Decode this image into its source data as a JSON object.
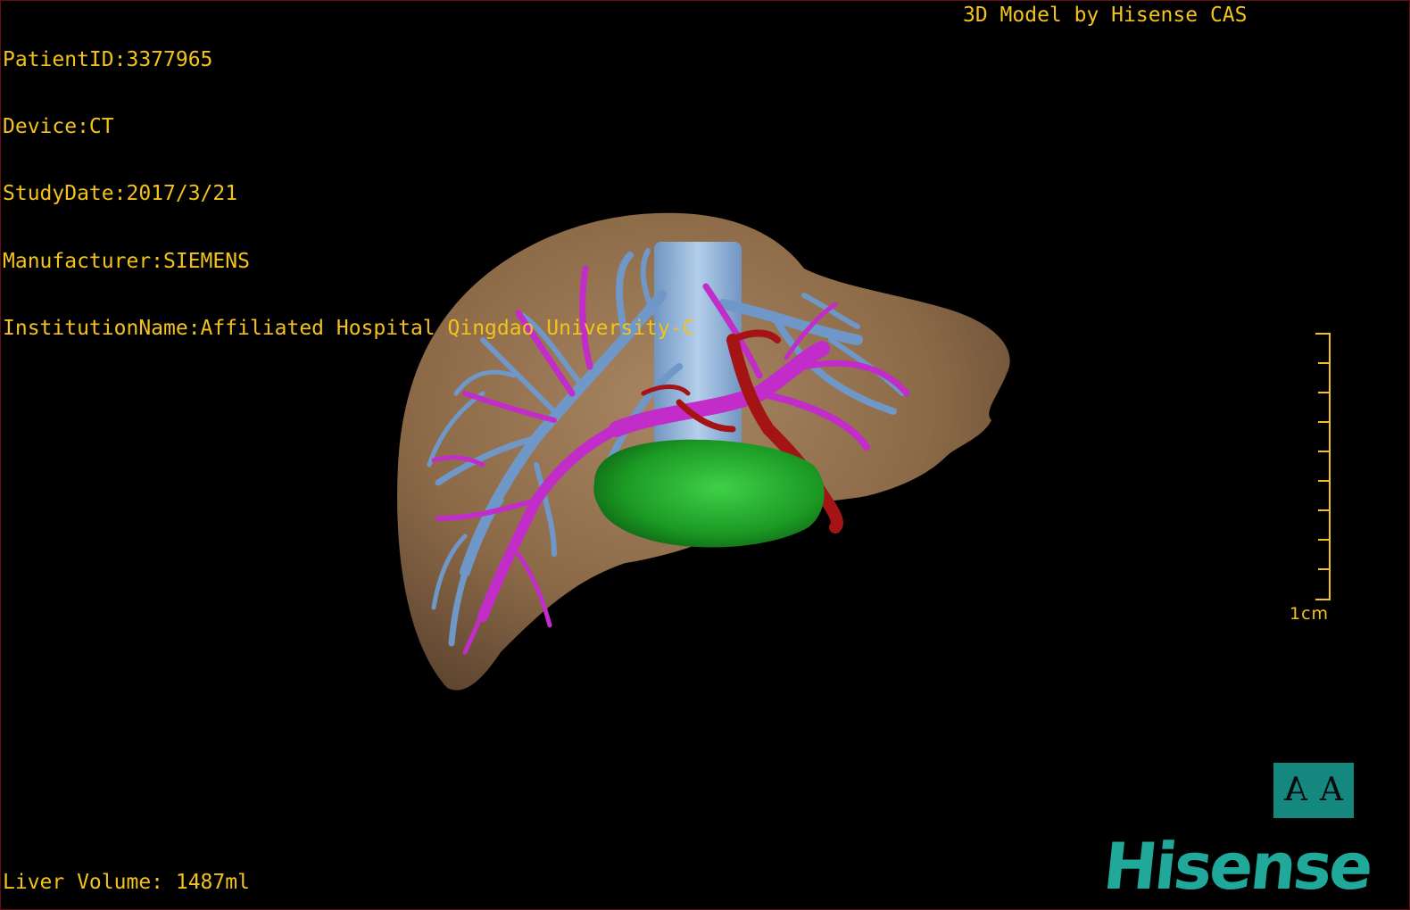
{
  "header": {
    "patient_id": "PatientID:3377965",
    "device": "Device:CT",
    "study_date": "StudyDate:2017/3/21",
    "manufacturer": "Manufacturer:SIEMENS",
    "institution": "InstitutionName:Affiliated Hospital Qingdao University-C"
  },
  "watermark": "3D Model by Hisense CAS",
  "footer": {
    "liver_volume": "Liver Volume: 1487ml"
  },
  "scale_bar": {
    "label": "1cm",
    "color": "#f3c21c"
  },
  "orientation_cube": {
    "left_letter": "A",
    "right_letter": "A",
    "color": "#14877f"
  },
  "brand": {
    "logo_text": "Hisense",
    "color": "#20a99b"
  },
  "model": {
    "structures": [
      {
        "name": "liver",
        "color": "#8c6a48"
      },
      {
        "name": "hepatic-veins",
        "color": "#6f97c8"
      },
      {
        "name": "portal-vein",
        "color": "#c22cc8"
      },
      {
        "name": "hepatic-artery",
        "color": "#a51414"
      },
      {
        "name": "gallbladder",
        "color": "#1fa528"
      },
      {
        "name": "inferior-vena-cava",
        "color": "#8db4e6"
      }
    ]
  }
}
